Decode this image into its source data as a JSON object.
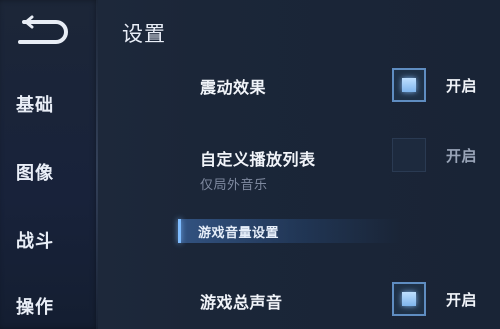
{
  "sidebar": {
    "items": [
      {
        "label": "基础"
      },
      {
        "label": "图像"
      },
      {
        "label": "战斗"
      },
      {
        "label": "操作"
      }
    ]
  },
  "main": {
    "title": "设置",
    "settings": [
      {
        "label": "震动效果",
        "checked": true,
        "state_label": "开启"
      },
      {
        "label": "自定义播放列表",
        "sublabel": "仅局外音乐",
        "checked": false,
        "state_label": "开启"
      }
    ],
    "section": {
      "title": "游戏音量设置"
    },
    "volume_settings": [
      {
        "label": "游戏总声音",
        "checked": true,
        "state_label": "开启"
      }
    ]
  },
  "icons": {
    "back": "back-arrow-icon"
  },
  "colors": {
    "accent": "#7fb4ec",
    "background": "#1b2638"
  }
}
